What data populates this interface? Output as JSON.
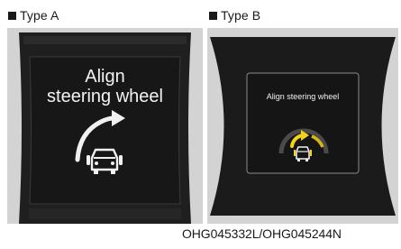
{
  "panels": {
    "type_a": {
      "label": "Type A",
      "message_line1": "Align",
      "message_line2": "steering wheel",
      "icon": "steering-wheel-alignment-icon"
    },
    "type_b": {
      "label": "Type B",
      "message": "Align steering wheel",
      "icon": "steering-wheel-alignment-icon"
    }
  },
  "caption": "OHG045332L/OHG045244N",
  "colors": {
    "display_background": "#1b1b1b",
    "frame_gray": "#d3d3d3",
    "arrow_type_b": "#f2d21a",
    "text": "#f2f2f2"
  }
}
